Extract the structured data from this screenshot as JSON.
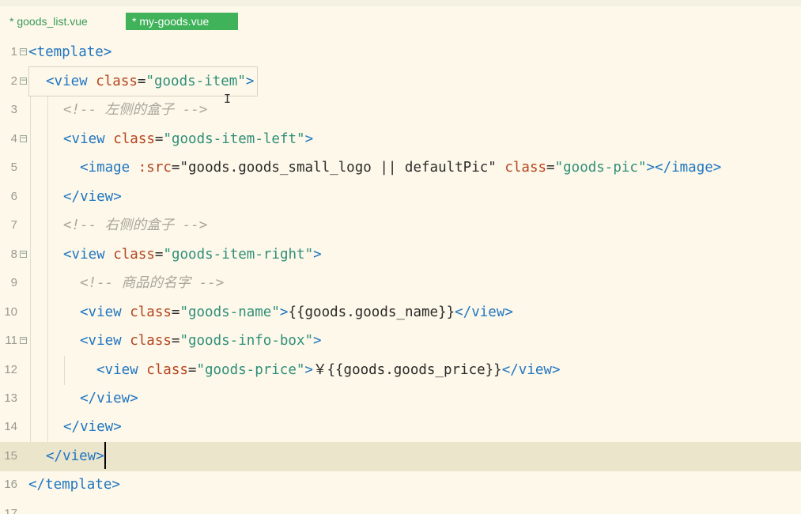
{
  "tabs": [
    {
      "label": "* goods_list.vue",
      "active": false
    },
    {
      "label": "* my-goods.vue",
      "active": true
    }
  ],
  "editor": {
    "current_line": 15,
    "lines": [
      {
        "n": "1",
        "fold": true,
        "segs": [
          [
            "tag",
            "<template>"
          ]
        ]
      },
      {
        "n": "2",
        "fold": true,
        "segs": [
          [
            "tag",
            "<view "
          ],
          [
            "attr",
            "class"
          ],
          [
            "plain",
            "="
          ],
          [
            "str",
            "\"goods-item\""
          ],
          [
            "tag",
            ">"
          ]
        ]
      },
      {
        "n": "3",
        "fold": false,
        "segs": [
          [
            "comment",
            "<!-- 左侧的盒子 -->"
          ]
        ]
      },
      {
        "n": "4",
        "fold": true,
        "segs": [
          [
            "tag",
            "<view "
          ],
          [
            "attr",
            "class"
          ],
          [
            "plain",
            "="
          ],
          [
            "str",
            "\"goods-item-left\""
          ],
          [
            "tag",
            ">"
          ]
        ]
      },
      {
        "n": "5",
        "fold": false,
        "segs": [
          [
            "tag",
            "<image "
          ],
          [
            "attr",
            ":src"
          ],
          [
            "plain",
            "=\"goods.goods_small_logo || defaultPic\" "
          ],
          [
            "attr",
            "class"
          ],
          [
            "plain",
            "="
          ],
          [
            "str",
            "\"goods-pic\""
          ],
          [
            "tag",
            "></image>"
          ]
        ]
      },
      {
        "n": "6",
        "fold": false,
        "segs": [
          [
            "tag",
            "</view>"
          ]
        ]
      },
      {
        "n": "7",
        "fold": false,
        "segs": [
          [
            "comment",
            "<!-- 右侧的盒子 -->"
          ]
        ]
      },
      {
        "n": "8",
        "fold": true,
        "segs": [
          [
            "tag",
            "<view "
          ],
          [
            "attr",
            "class"
          ],
          [
            "plain",
            "="
          ],
          [
            "str",
            "\"goods-item-right\""
          ],
          [
            "tag",
            ">"
          ]
        ]
      },
      {
        "n": "9",
        "fold": false,
        "segs": [
          [
            "comment",
            "<!-- 商品的名字 -->"
          ]
        ]
      },
      {
        "n": "10",
        "fold": false,
        "segs": [
          [
            "tag",
            "<view "
          ],
          [
            "attr",
            "class"
          ],
          [
            "plain",
            "="
          ],
          [
            "str",
            "\"goods-name\""
          ],
          [
            "tag",
            ">"
          ],
          [
            "plain",
            "{{goods.goods_name}}"
          ],
          [
            "tag",
            "</view>"
          ]
        ]
      },
      {
        "n": "11",
        "fold": true,
        "segs": [
          [
            "tag",
            "<view "
          ],
          [
            "attr",
            "class"
          ],
          [
            "plain",
            "="
          ],
          [
            "str",
            "\"goods-info-box\""
          ],
          [
            "tag",
            ">"
          ]
        ]
      },
      {
        "n": "12",
        "fold": false,
        "segs": [
          [
            "tag",
            "<view "
          ],
          [
            "attr",
            "class"
          ],
          [
            "plain",
            "="
          ],
          [
            "str",
            "\"goods-price\""
          ],
          [
            "tag",
            ">"
          ],
          [
            "plain",
            "￥{{goods.goods_price}}"
          ],
          [
            "tag",
            "</view>"
          ]
        ]
      },
      {
        "n": "13",
        "fold": false,
        "segs": [
          [
            "tag",
            "</view>"
          ]
        ]
      },
      {
        "n": "14",
        "fold": false,
        "segs": [
          [
            "tag",
            "</view>"
          ]
        ]
      },
      {
        "n": "15",
        "fold": false,
        "segs": [
          [
            "tag",
            "</view>"
          ]
        ]
      },
      {
        "n": "16",
        "fold": false,
        "segs": [
          [
            "tag",
            "</template>"
          ]
        ]
      },
      {
        "n": "17",
        "fold": false,
        "segs": []
      }
    ]
  }
}
